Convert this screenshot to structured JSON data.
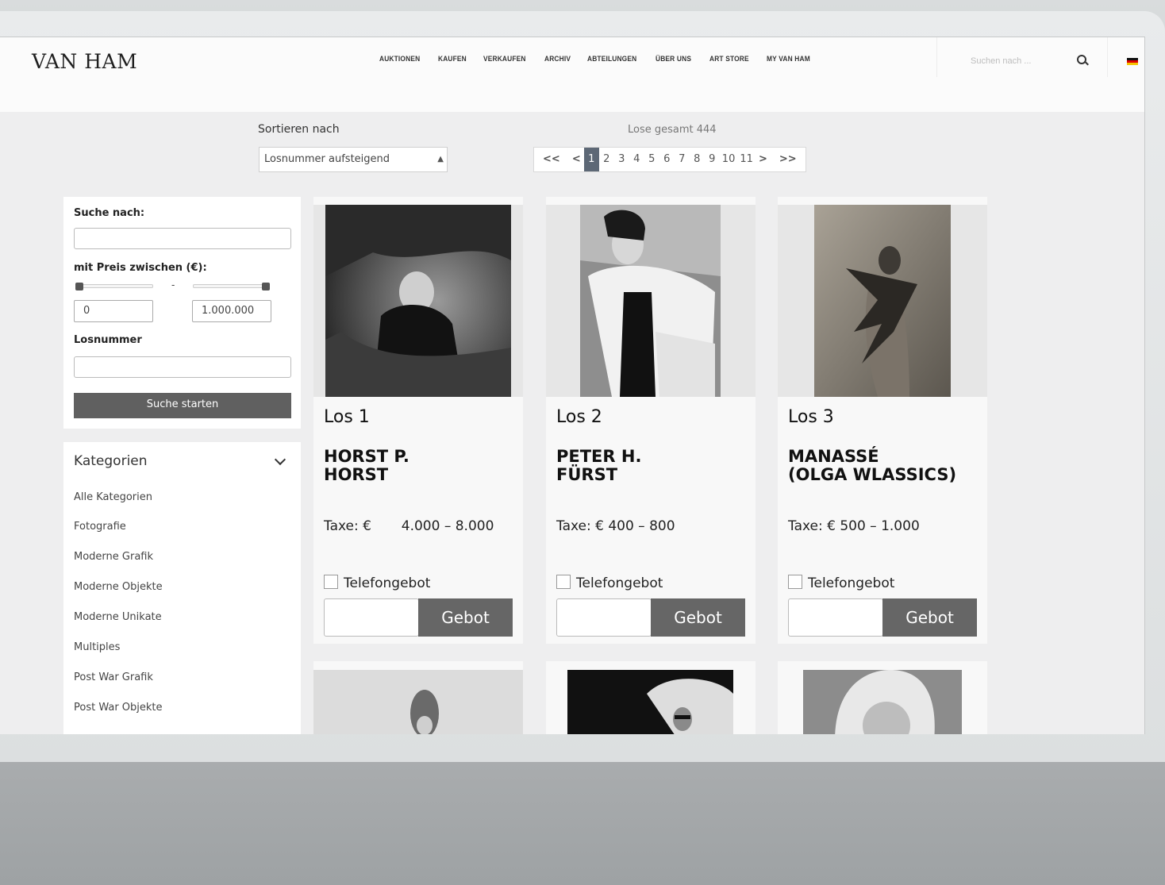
{
  "brand": {
    "name": "VAN HAM"
  },
  "nav": [
    "AUKTIONEN",
    "KAUFEN",
    "VERKAUFEN",
    "ARCHIV",
    "ABTEILUNGEN",
    "ÜBER UNS",
    "ART STORE",
    "MY VAN HAM"
  ],
  "search": {
    "placeholder": "Suchen nach ..."
  },
  "sort": {
    "label": "Sortieren nach",
    "selected": "Losnummer aufsteigend"
  },
  "total": "Lose gesamt 444",
  "pagination": {
    "first": "<<",
    "prev": "<",
    "pages": [
      "1",
      "2",
      "3",
      "4",
      "5",
      "6",
      "7",
      "8",
      "9",
      "10",
      "11"
    ],
    "active": "1",
    "next": ">",
    "last": ">>"
  },
  "filter": {
    "search_label": "Suche nach:",
    "price_label": "mit Preis zwischen (€):",
    "price_min": "0",
    "price_max": "1.000.000",
    "lot_label": "Losnummer",
    "submit": "Suche starten"
  },
  "categories": {
    "title": "Kategorien",
    "items": [
      "Alle Kategorien",
      "Fotografie",
      "Moderne Grafik",
      "Moderne Objekte",
      "Moderne Unikate",
      "Multiples",
      "Post War Grafik",
      "Post War Objekte"
    ]
  },
  "lots": [
    {
      "lot": "Los 1",
      "artist": "HORST P.\nHORST",
      "estimate": "Taxe: €       4.000 – 8.000",
      "phone_bid": "Telefongebot",
      "bid_button": "Gebot"
    },
    {
      "lot": "Los 2",
      "artist": "PETER H.\nFÜRST",
      "estimate": "Taxe: € 400 – 800",
      "phone_bid": "Telefongebot",
      "bid_button": "Gebot"
    },
    {
      "lot": "Los 3",
      "artist": "MANASSÉ\n(OLGA WLASSICS)",
      "estimate": "Taxe: € 500 – 1.000",
      "phone_bid": "Telefongebot",
      "bid_button": "Gebot"
    }
  ],
  "colors": {
    "active_page": "#5d6876",
    "button": "#606060",
    "gebot": "#666666"
  }
}
